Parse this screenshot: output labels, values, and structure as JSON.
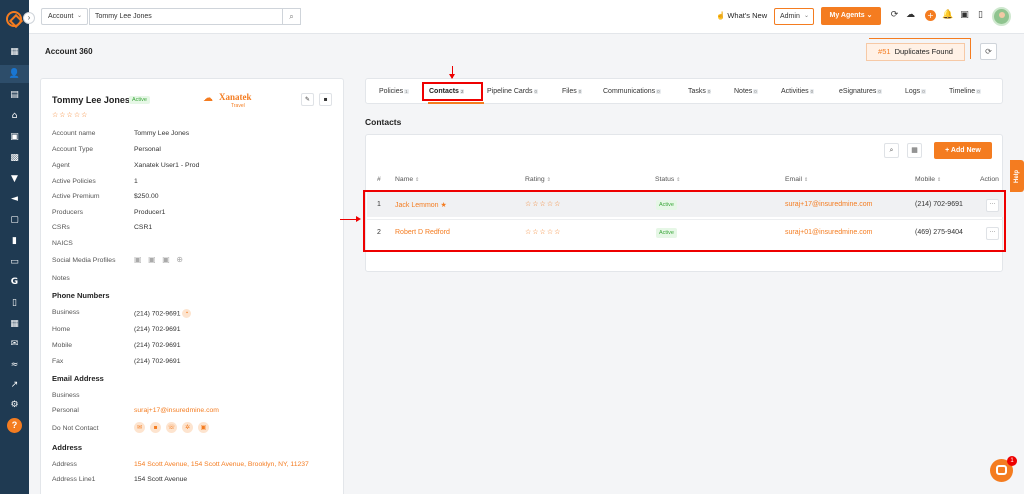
{
  "topbar": {
    "account_select": "Account",
    "search_value": "Tommy Lee Jones",
    "whats_new": "What's New",
    "admin_select": "Admin",
    "my_agents": "My Agents"
  },
  "page": {
    "title": "Account 360",
    "duplicates_count": "#51",
    "duplicates_label": "Duplicates Found"
  },
  "account": {
    "name": "Tommy Lee Jones",
    "status": "Active",
    "rating": 0,
    "brand_name": "Xanatek",
    "brand_sub": "Travel",
    "fields": [
      {
        "label": "Account name",
        "value": "Tommy Lee Jones"
      },
      {
        "label": "Account Type",
        "value": "Personal"
      },
      {
        "label": "Agent",
        "value": "Xanatek User1 - Prod"
      },
      {
        "label": "Active Policies",
        "value": "1"
      },
      {
        "label": "Active Premium",
        "value": "$250.00"
      },
      {
        "label": "Producers",
        "value": "Producer1"
      },
      {
        "label": "CSRs",
        "value": "CSR1"
      },
      {
        "label": "NAICS",
        "value": ""
      },
      {
        "label": "Social Media Profiles",
        "value": ""
      },
      {
        "label": "Notes",
        "value": ""
      }
    ],
    "phone_section": "Phone Numbers",
    "phones": [
      {
        "label": "Business",
        "value": "(214) 702-9691"
      },
      {
        "label": "Home",
        "value": "(214) 702-9691"
      },
      {
        "label": "Mobile",
        "value": "(214) 702-9691"
      },
      {
        "label": "Fax",
        "value": "(214) 702-9691"
      }
    ],
    "email_section": "Email Address",
    "emails": [
      {
        "label": "Business",
        "value": ""
      },
      {
        "label": "Personal",
        "value": "suraj+17@insuredmine.com"
      }
    ],
    "do_not_contact_label": "Do Not Contact",
    "address_section": "Address",
    "addresses": [
      {
        "label": "Address",
        "value": "154 Scott Avenue, 154 Scott Avenue, Brooklyn, NY, 11237"
      },
      {
        "label": "Address Line1",
        "value": "154 Scott Avenue"
      }
    ]
  },
  "tabs": [
    {
      "label": "Policies",
      "count": "1"
    },
    {
      "label": "Contacts",
      "count": "2"
    },
    {
      "label": "Pipeline Cards",
      "count": "0"
    },
    {
      "label": "Files",
      "count": "0"
    },
    {
      "label": "Communications",
      "count": "0"
    },
    {
      "label": "Tasks",
      "count": "0"
    },
    {
      "label": "Notes",
      "count": "0"
    },
    {
      "label": "Activities",
      "count": "0"
    },
    {
      "label": "eSignatures",
      "count": "0"
    },
    {
      "label": "Logs",
      "count": "0"
    },
    {
      "label": "Timeline",
      "count": "0"
    }
  ],
  "contacts": {
    "title": "Contacts",
    "add_new": "Add New",
    "columns": [
      "#",
      "Name",
      "Rating",
      "Status",
      "Email",
      "Mobile",
      "Action"
    ],
    "rows": [
      {
        "num": "1",
        "name": "Jack Lemmon",
        "primary": true,
        "rating": 0,
        "status": "Active",
        "email": "suraj+17@insuredmine.com",
        "mobile": "(214) 702-9691"
      },
      {
        "num": "2",
        "name": "Robert D Redford",
        "primary": false,
        "rating": 0,
        "status": "Active",
        "email": "suraj+01@insuredmine.com",
        "mobile": "(469) 275-9404"
      }
    ]
  },
  "help_tab": "Help",
  "chat_badge": "1",
  "colors": {
    "brand": "#f47c20",
    "sidebar": "#1f3a52",
    "annotation": "#e00000",
    "active_green": "#3aa63a"
  }
}
